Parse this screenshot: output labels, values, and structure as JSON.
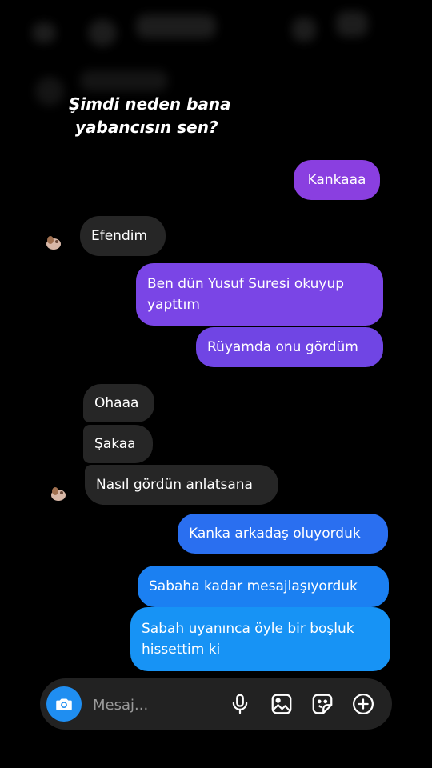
{
  "caption": {
    "line1": "Şimdi neden bana",
    "line2": "yabancısın sen?"
  },
  "messages": [
    {
      "text": "Kankaaa",
      "side": "out"
    },
    {
      "text": "Efendim",
      "side": "in"
    },
    {
      "text": "Ben dün Yusuf Suresi okuyup yapttım",
      "side": "out"
    },
    {
      "text": "Rüyamda onu gördüm",
      "side": "out"
    },
    {
      "text": "Ohaaa",
      "side": "in"
    },
    {
      "text": "Şakaa",
      "side": "in"
    },
    {
      "text": "Nasıl gördün anlatsana",
      "side": "in"
    },
    {
      "text": "Kanka arkadaş oluyorduk",
      "side": "out"
    },
    {
      "text": "Sabaha kadar mesajlaşıyorduk",
      "side": "out"
    },
    {
      "text": "Sabah uyanınca öyle bir boşluk hissettim ki",
      "side": "out"
    }
  ],
  "composer": {
    "placeholder": "Mesaj..."
  },
  "icons": {
    "camera": "camera-icon",
    "microphone": "microphone-icon",
    "gallery": "gallery-icon",
    "sticker": "sticker-icon",
    "plus": "plus-circle-icon"
  },
  "colors": {
    "background": "#000000",
    "incoming_bubble": "#262626",
    "outgoing_purple": "#7b3fe4",
    "outgoing_blue": "#1e7bf0",
    "camera_button": "#1f8ef1"
  }
}
